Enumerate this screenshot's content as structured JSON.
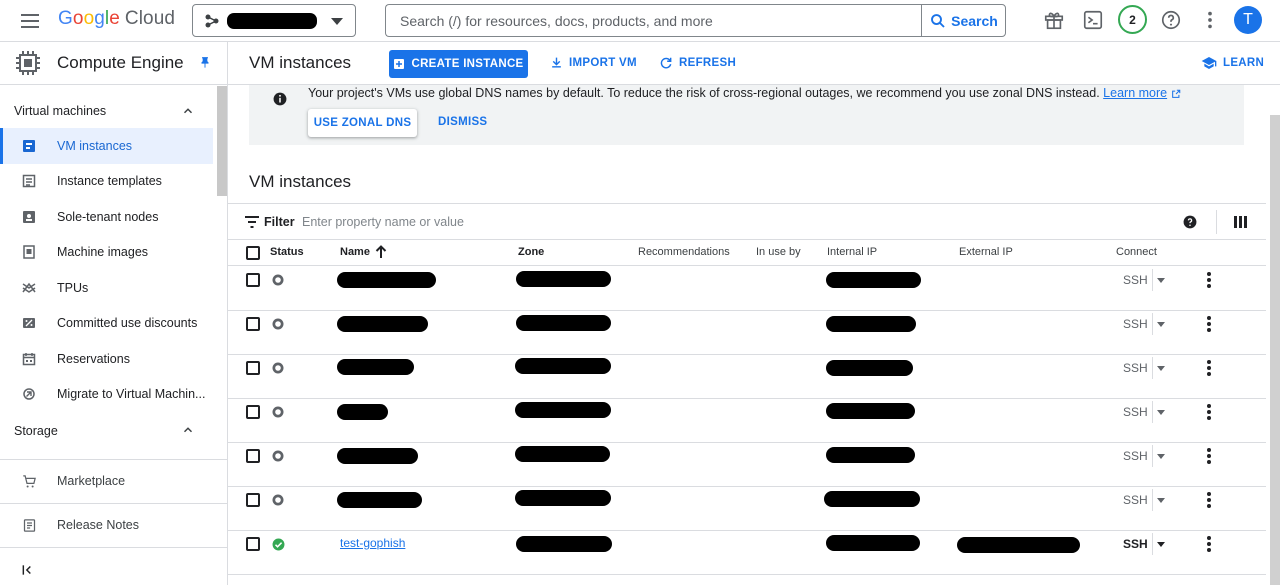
{
  "topbar": {
    "logo": {
      "g1": "G",
      "g2": "o",
      "g3": "o",
      "g4": "g",
      "g5": "l",
      "g6": "e",
      "cloud": "Cloud"
    },
    "search_placeholder": "Search (/) for resources, docs, products, and more",
    "search_button": "Search",
    "notification_count": "2",
    "avatar_initial": "T"
  },
  "sidebar": {
    "product": "Compute Engine",
    "sections": {
      "vm": "Virtual machines",
      "storage": "Storage"
    },
    "items": [
      {
        "label": "VM instances",
        "icon": "vm-instances-icon"
      },
      {
        "label": "Instance templates",
        "icon": "instance-templates-icon"
      },
      {
        "label": "Sole-tenant nodes",
        "icon": "sole-tenant-icon"
      },
      {
        "label": "Machine images",
        "icon": "machine-images-icon"
      },
      {
        "label": "TPUs",
        "icon": "tpu-icon"
      },
      {
        "label": "Committed use discounts",
        "icon": "discount-icon"
      },
      {
        "label": "Reservations",
        "icon": "reservations-icon"
      },
      {
        "label": "Migrate to Virtual Machin..."
      }
    ],
    "links": {
      "marketplace": "Marketplace",
      "release_notes": "Release Notes"
    }
  },
  "header": {
    "title": "VM instances",
    "create": "CREATE INSTANCE",
    "import": "IMPORT VM",
    "refresh": "REFRESH",
    "learn": "LEARN"
  },
  "banner": {
    "message": "Your project's VMs use global DNS names by default. To reduce the risk of cross-regional outages, we recommend you use zonal DNS instead.",
    "learn_more": "Learn more",
    "use_zonal": "USE ZONAL DNS",
    "dismiss": "DISMISS"
  },
  "table": {
    "title": "VM instances",
    "filter_label": "Filter",
    "filter_placeholder": "Enter property name or value",
    "columns": {
      "status": "Status",
      "name": "Name",
      "zone": "Zone",
      "recommendations": "Recommendations",
      "in_use_by": "In use by",
      "internal_ip": "Internal IP",
      "external_ip": "External IP",
      "connect": "Connect"
    },
    "rows": [
      {
        "status": "stopped",
        "connect": "SSH"
      },
      {
        "status": "stopped",
        "connect": "SSH"
      },
      {
        "status": "stopped",
        "connect": "SSH"
      },
      {
        "status": "stopped",
        "connect": "SSH"
      },
      {
        "status": "stopped",
        "connect": "SSH"
      },
      {
        "status": "stopped",
        "connect": "SSH"
      },
      {
        "status": "running",
        "name": "test-gophish",
        "connect": "SSH"
      }
    ]
  },
  "colors": {
    "accent": "#1a73e8",
    "running": "#34a853",
    "stopped": "#5f6368",
    "redaction": "#000000"
  }
}
